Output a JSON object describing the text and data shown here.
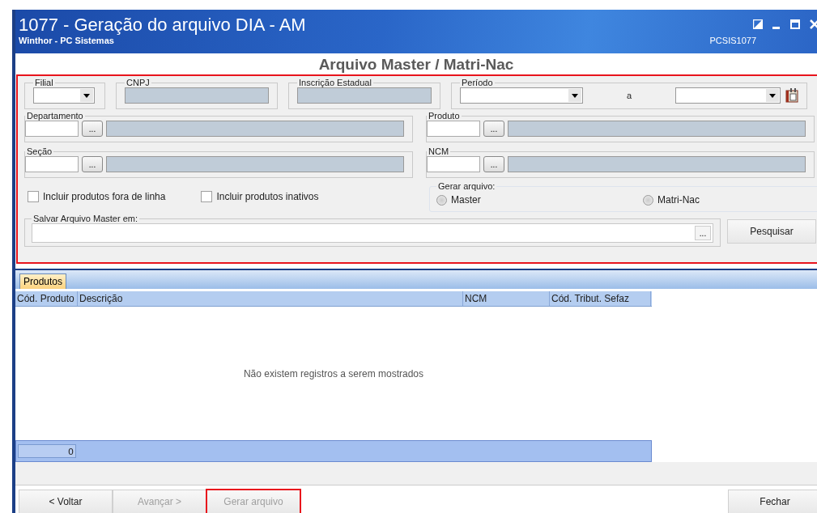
{
  "window": {
    "title": "1077 - Geração do arquivo DIA - AM",
    "subtitle": "Winthor - PC Sistemas",
    "code": "PCSIS1077"
  },
  "heading": "Arquivo Master / Matri-Nac",
  "form": {
    "highlighted": true,
    "filial": {
      "label": "Filial"
    },
    "cnpj": {
      "label": "CNPJ"
    },
    "inscricao": {
      "label": "Inscrição Estadual"
    },
    "periodo": {
      "label": "Período",
      "separator": "a"
    },
    "lookups": [
      {
        "label": "Departamento",
        "browse": "..."
      },
      {
        "label": "Produto",
        "browse": "..."
      },
      {
        "label": "Seção",
        "browse": "..."
      },
      {
        "label": "NCM",
        "browse": "..."
      }
    ],
    "checkboxes": [
      {
        "label": "Incluir produtos fora de linha",
        "checked": false
      },
      {
        "label": "Incluir produtos inativos",
        "checked": false
      }
    ],
    "gerar": {
      "label": "Gerar arquivo:",
      "options": [
        {
          "label": "Master",
          "selected": false
        },
        {
          "label": "Matri-Nac",
          "selected": false
        }
      ]
    },
    "salvar": {
      "label": "Salvar Arquivo Master em:",
      "browse": "..."
    },
    "search_button": "Pesquisar"
  },
  "tabs": [
    {
      "label": "Produtos",
      "selected": true
    }
  ],
  "table": {
    "columns": [
      "Cód. Produto",
      "Descrição",
      "NCM",
      "Cód. Tribut. Sefaz"
    ],
    "empty_message": "Não existem registros a serem mostrados",
    "count": "0"
  },
  "buttons": [
    {
      "label": "< Voltar",
      "disabled": false,
      "highlighted": false
    },
    {
      "label": "Avançar >",
      "disabled": true,
      "highlighted": false
    },
    {
      "label": "Gerar arquivo",
      "disabled": true,
      "highlighted": true
    }
  ],
  "close_button": {
    "label": "Fechar"
  }
}
